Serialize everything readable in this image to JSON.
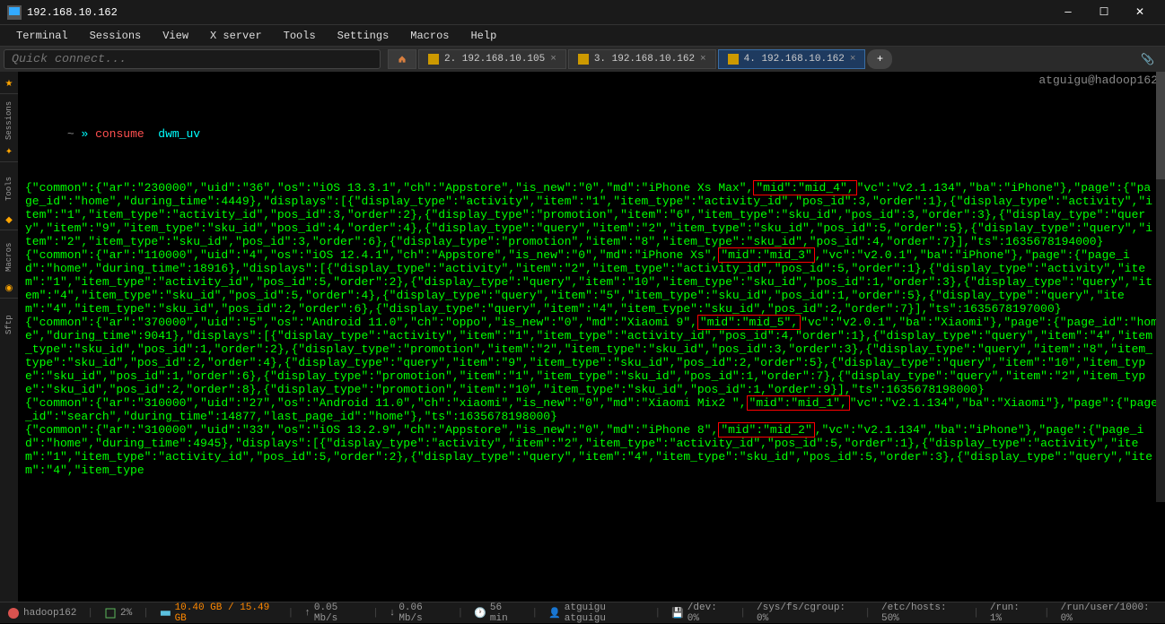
{
  "window": {
    "title": "192.168.10.162"
  },
  "menubar": {
    "items": [
      "Terminal",
      "Sessions",
      "View",
      "X server",
      "Tools",
      "Settings",
      "Macros",
      "Help"
    ]
  },
  "toolbar": {
    "quick_connect_placeholder": "Quick connect..."
  },
  "tabs": [
    {
      "label": "2. 192.168.10.105",
      "active": false
    },
    {
      "label": "3. 192.168.10.162",
      "active": false
    },
    {
      "label": "4. 192.168.10.162",
      "active": true
    }
  ],
  "sidebar": {
    "items": [
      "Sessions",
      "Tools",
      "Macros",
      "Sftp"
    ]
  },
  "terminal": {
    "user_host": "atguigu@hadoop162",
    "prompt_tilde": "~",
    "prompt_arrow": "»",
    "cmd": "consume",
    "arg": "dwm_uv",
    "lines": [
      {
        "text": "{\"common\":{\"ar\":\"230000\",\"uid\":\"36\",\"os\":\"iOS 13.3.1\",\"ch\":\"Appstore\",\"is_new\":\"0\",\"md\":\"iPhone Xs Max\",",
        "highlight": "\"mid\":\"mid_4\",",
        "after": "\"vc\":\"v2.1.134\",\"ba\":\"iPhone\"},\"page\":{\"page_id\":\"home\",\"during_time\":4449},\"displays\":[{\"display_type\":\"activity\",\"item\":\"1\",\"item_type\":\"activity_id\",\"pos_id\":3,\"order\":1},{\"display_type\":\"activity\",\"item\":\"1\",\"item_type\":\"activity_id\",\"pos_id\":3,\"order\":2},{\"display_type\":\"promotion\",\"item\":\"6\",\"item_type\":\"sku_id\",\"pos_id\":3,\"order\":3},{\"display_type\":\"query\",\"item\":\"9\",\"item_type\":\"sku_id\",\"pos_id\":4,\"order\":4},{\"display_type\":\"query\",\"item\":\"2\",\"item_type\":\"sku_id\",\"pos_id\":5,\"order\":5},{\"display_type\":\"query\",\"item\":\"2\",\"item_type\":\"sku_id\",\"pos_id\":3,\"order\":6},{\"display_type\":\"promotion\",\"item\":\"8\",\"item_type\":\"sku_id\",\"pos_id\":4,\"order\":7}],\"ts\":1635678194000}"
      },
      {
        "text": "{\"common\":{\"ar\":\"110000\",\"uid\":\"4\",\"os\":\"iOS 12.4.1\",\"ch\":\"Appstore\",\"is_new\":\"0\",\"md\":\"iPhone Xs\",",
        "highlight": "\"mid\":\"mid_3\"",
        "after": ",\"vc\":\"v2.0.1\",\"ba\":\"iPhone\"},\"page\":{\"page_id\":\"home\",\"during_time\":18916},\"displays\":[{\"display_type\":\"activity\",\"item\":\"2\",\"item_type\":\"activity_id\",\"pos_id\":5,\"order\":1},{\"display_type\":\"activity\",\"item\":\"1\",\"item_type\":\"activity_id\",\"pos_id\":5,\"order\":2},{\"display_type\":\"query\",\"item\":\"10\",\"item_type\":\"sku_id\",\"pos_id\":1,\"order\":3},{\"display_type\":\"query\",\"item\":\"4\",\"item_type\":\"sku_id\",\"pos_id\":5,\"order\":4},{\"display_type\":\"query\",\"item\":\"5\",\"item_type\":\"sku_id\",\"pos_id\":1,\"order\":5},{\"display_type\":\"query\",\"item\":\"4\",\"item_type\":\"sku_id\",\"pos_id\":2,\"order\":6},{\"display_type\":\"query\",\"item\":\"4\",\"item_type\":\"sku_id\",\"pos_id\":2,\"order\":7}],\"ts\":1635678197000}"
      },
      {
        "text": "{\"common\":{\"ar\":\"370000\",\"uid\":\"5\",\"os\":\"Android 11.0\",\"ch\":\"oppo\",\"is_new\":\"0\",\"md\":\"Xiaomi 9\",",
        "highlight": "\"mid\":\"mid_5\",",
        "after": "\"vc\":\"v2.0.1\",\"ba\":\"Xiaomi\"},\"page\":{\"page_id\":\"home\",\"during_time\":9041},\"displays\":[{\"display_type\":\"activity\",\"item\":\"1\",\"item_type\":\"activity_id\",\"pos_id\":4,\"order\":1},{\"display_type\":\"query\",\"item\":\"4\",\"item_type\":\"sku_id\",\"pos_id\":1,\"order\":2},{\"display_type\":\"promotion\",\"item\":\"2\",\"item_type\":\"sku_id\",\"pos_id\":3,\"order\":3},{\"display_type\":\"query\",\"item\":\"8\",\"item_type\":\"sku_id\",\"pos_id\":2,\"order\":4},{\"display_type\":\"query\",\"item\":\"9\",\"item_type\":\"sku_id\",\"pos_id\":2,\"order\":5},{\"display_type\":\"query\",\"item\":\"10\",\"item_type\":\"sku_id\",\"pos_id\":1,\"order\":6},{\"display_type\":\"promotion\",\"item\":\"1\",\"item_type\":\"sku_id\",\"pos_id\":1,\"order\":7},{\"display_type\":\"query\",\"item\":\"2\",\"item_type\":\"sku_id\",\"pos_id\":2,\"order\":8},{\"display_type\":\"promotion\",\"item\":\"10\",\"item_type\":\"sku_id\",\"pos_id\":1,\"order\":9}],\"ts\":1635678198000}"
      },
      {
        "text": "{\"common\":{\"ar\":\"310000\",\"uid\":\"27\",\"os\":\"Android 11.0\",\"ch\":\"xiaomi\",\"is_new\":\"0\",\"md\":\"Xiaomi Mix2 \",",
        "highlight": "\"mid\":\"mid_1\",",
        "after": "\"vc\":\"v2.1.134\",\"ba\":\"Xiaomi\"},\"page\":{\"page_id\":\"search\",\"during_time\":14877,\"last_page_id\":\"home\"},\"ts\":1635678198000}"
      },
      {
        "text": "{\"common\":{\"ar\":\"310000\",\"uid\":\"33\",\"os\":\"iOS 13.2.9\",\"ch\":\"Appstore\",\"is_new\":\"0\",\"md\":\"iPhone 8\",",
        "highlight": "\"mid\":\"mid_2\"",
        "after": ",\"vc\":\"v2.1.134\",\"ba\":\"iPhone\"},\"page\":{\"page_id\":\"home\",\"during_time\":4945},\"displays\":[{\"display_type\":\"activity\",\"item\":\"2\",\"item_type\":\"activity_id\",\"pos_id\":5,\"order\":1},{\"display_type\":\"activity\",\"item\":\"1\",\"item_type\":\"activity_id\",\"pos_id\":5,\"order\":2},{\"display_type\":\"query\",\"item\":\"4\",\"item_type\":\"sku_id\",\"pos_id\":5,\"order\":3},{\"display_type\":\"query\",\"item\":\"4\",\"item_type"
      }
    ]
  },
  "statusbar": {
    "host": "hadoop162",
    "cpu": "2%",
    "mem": "10.40 GB / 15.49 GB",
    "up": "0.05 Mb/s",
    "down": "0.06 Mb/s",
    "uptime": "56 min",
    "user": "atguigu  atguigu",
    "dev": "/dev: 0%",
    "sysfs": "/sys/fs/cgroup: 0%",
    "etc": "/etc/hosts: 50%",
    "run": "/run: 1%",
    "runuser": "/run/user/1000: 0%"
  }
}
